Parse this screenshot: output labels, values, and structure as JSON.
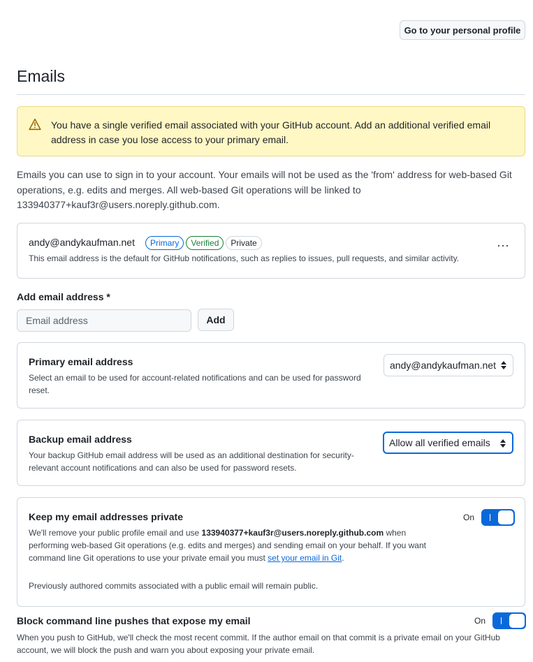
{
  "header": {
    "profile_button": "Go to your personal profile"
  },
  "page_title": "Emails",
  "warning": {
    "text": "You have a single verified email associated with your GitHub account. Add an additional verified email address in case you lose access to your primary email."
  },
  "intro": "Emails you can use to sign in to your account. Your emails will not be used as the 'from' address for web-based Git operations, e.g. edits and merges. All web-based Git operations will be linked to 133940377+kauf3r@users.noreply.github.com.",
  "email_card": {
    "address": "andy@andykaufman.net",
    "badges": {
      "primary": "Primary",
      "verified": "Verified",
      "private": "Private"
    },
    "description": "This email address is the default for GitHub notifications, such as replies to issues, pull requests, and similar activity.",
    "menu": "⋯"
  },
  "add_email": {
    "label": "Add email address *",
    "placeholder": "Email address",
    "button": "Add"
  },
  "primary_email": {
    "heading": "Primary email address",
    "description": "Select an email to be used for account-related notifications and can be used for password reset.",
    "selected": "andy@andykaufman.net"
  },
  "backup_email": {
    "heading": "Backup email address",
    "description": "Your backup GitHub email address will be used as an additional destination for security-relevant account notifications and can also be used for password resets.",
    "selected": "Allow all verified emails"
  },
  "keep_private": {
    "heading": "Keep my email addresses private",
    "desc_part1": "We'll remove your public profile email and use ",
    "noreply_email": "133940377+kauf3r@users.noreply.github.com",
    "desc_part2": " when performing web-based Git operations (e.g. edits and merges) and sending email on your behalf. If you want command line Git operations to use your private email you must ",
    "link_text": "set your email in Git",
    "desc_part3": ".",
    "note": "Previously authored commits associated with a public email will remain public.",
    "toggle_state": "On",
    "enabled": true
  },
  "block_pushes": {
    "heading": "Block command line pushes that expose my email",
    "description": "When you push to GitHub, we'll check the most recent commit. If the author email on that commit is a private email on your GitHub account, we will block the push and warn you about exposing your private email.",
    "toggle_state": "On",
    "enabled": true
  },
  "colors": {
    "accent": "#0969da",
    "warning_bg": "#fff8c5",
    "success": "#1a7f37"
  }
}
